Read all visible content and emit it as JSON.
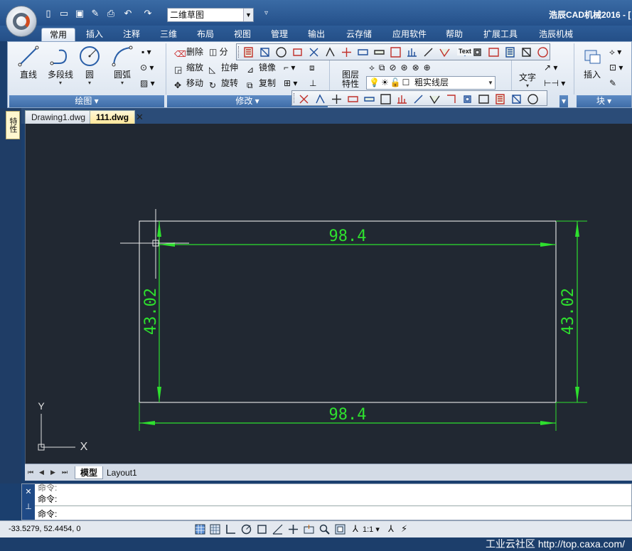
{
  "window": {
    "title": "浩辰CAD机械2016 - [",
    "workspace": "二维草图"
  },
  "ribbon_tabs": [
    "常用",
    "插入",
    "注释",
    "三维",
    "布局",
    "视图",
    "管理",
    "输出",
    "云存储",
    "应用软件",
    "帮助",
    "扩展工具",
    "浩辰机械"
  ],
  "groups": {
    "draw": "绘图",
    "modify": "修改",
    "block": "块"
  },
  "draw_tools": {
    "line": "直线",
    "polyline": "多段线",
    "circle": "圆",
    "arc": "圆弧"
  },
  "modify_tools": {
    "erase": "删除",
    "scale": "缩放",
    "stretch": "拉伸",
    "mirror": "镜像",
    "move": "移动",
    "rotate": "旋转",
    "copy": "复制"
  },
  "layer": {
    "properties_label": "图层\n特性",
    "current": "粗实线层"
  },
  "text_tool": "文字",
  "insert_tool": "插入",
  "toolbar_text_button": "Text",
  "side_panel_label": "特性",
  "documents": [
    {
      "name": "Drawing1.dwg",
      "active": false
    },
    {
      "name": "111.dwg",
      "active": true
    }
  ],
  "drawing": {
    "dim_width": "98.4",
    "dim_height": "43.02",
    "ucs_y": "Y",
    "ucs_x": "X"
  },
  "layout_tabs": [
    "模型",
    "Layout1"
  ],
  "command": {
    "prompt": "命令:",
    "lines": [
      "命令:",
      "命令:",
      "命令:"
    ]
  },
  "status": {
    "coords": "-33.5279, 52.4454, 0",
    "scale": "1:1"
  },
  "watermark": "工业云社区 http://top.caxa.com/",
  "colors": {
    "canvas": "#212832",
    "dimension": "#2ee02e",
    "geometry": "#ffffff"
  }
}
